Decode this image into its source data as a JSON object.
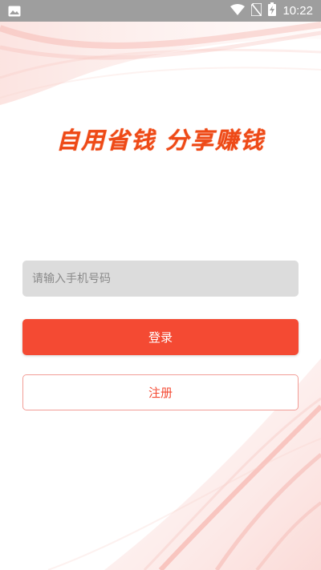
{
  "status_bar": {
    "time": "10:22",
    "icons": [
      "image-notification-icon",
      "wifi-icon",
      "no-sim-icon",
      "battery-charging-icon"
    ]
  },
  "main": {
    "slogan": "自用省钱  分享赚钱",
    "phone_input": {
      "placeholder": "请输入手机号码",
      "value": ""
    },
    "login_label": "登录",
    "register_label": "注册"
  },
  "colors": {
    "accent": "#f44a33",
    "slogan": "#ee4a17",
    "status_bar": "#9e9e9e",
    "input_bg": "#dcdcdc",
    "register_border": "#f29d96"
  }
}
